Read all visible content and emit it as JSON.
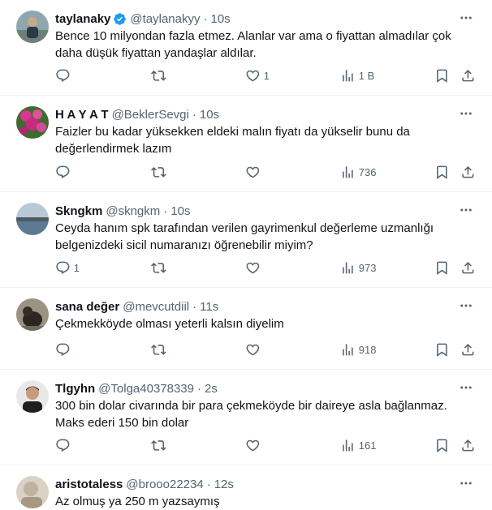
{
  "tweets": [
    {
      "name": "taylanaky",
      "verified": true,
      "handle": "@taylanakyy",
      "time": "10s",
      "text": "Bence 10 milyondan fazla etmez. Alanlar var ama o fiyattan almadılar çok daha düşük fiyattan yandaşlar aldılar.",
      "replies": "",
      "retweets": "",
      "likes": "1",
      "views": "1 B"
    },
    {
      "name": "H A Y A T",
      "verified": false,
      "handle": "@BeklerSevgi",
      "time": "10s",
      "text": "Faizler bu kadar yüksekken eldeki malın fiyatı da yükselir bunu da değerlendirmek lazım",
      "replies": "",
      "retweets": "",
      "likes": "",
      "views": "736"
    },
    {
      "name": "Skngkm",
      "verified": false,
      "handle": "@skngkm",
      "time": "10s",
      "text": "Ceyda hanım spk tarafından verilen gayrimenkul değerleme uzmanlığı belgenizdeki sicil numaranızı öğrenebilir miyim?",
      "replies": "1",
      "retweets": "",
      "likes": "",
      "views": "973"
    },
    {
      "name": "sana değer",
      "verified": false,
      "handle": "@mevcutdiil",
      "time": "11s",
      "text": "Çekmekköyde olması yeterli kalsın diyelim",
      "replies": "",
      "retweets": "",
      "likes": "",
      "views": "918"
    },
    {
      "name": "Tlgyhn",
      "verified": false,
      "handle": "@Tolga40378339",
      "time": "2s",
      "text": "300 bin dolar civarında bir para çekmeköyde bir daireye asla bağlanmaz. Maks ederi 150 bin dolar",
      "replies": "",
      "retweets": "",
      "likes": "",
      "views": "161"
    },
    {
      "name": "aristotaless",
      "verified": false,
      "handle": "@brooo22234",
      "time": "12s",
      "text": "Az olmuş ya 250 m yazsaymış"
    }
  ],
  "separator": "·",
  "icons": {
    "verified": "verified-badge-icon",
    "more": "more-horizontal-icon",
    "reply": "reply-icon",
    "retweet": "retweet-icon",
    "like": "heart-icon",
    "views": "views-icon",
    "bookmark": "bookmark-icon",
    "share": "share-icon"
  },
  "colors": {
    "text": "#0f1419",
    "secondary": "#536471",
    "verified": "#1d9bf0",
    "divider": "#eff3f4"
  }
}
